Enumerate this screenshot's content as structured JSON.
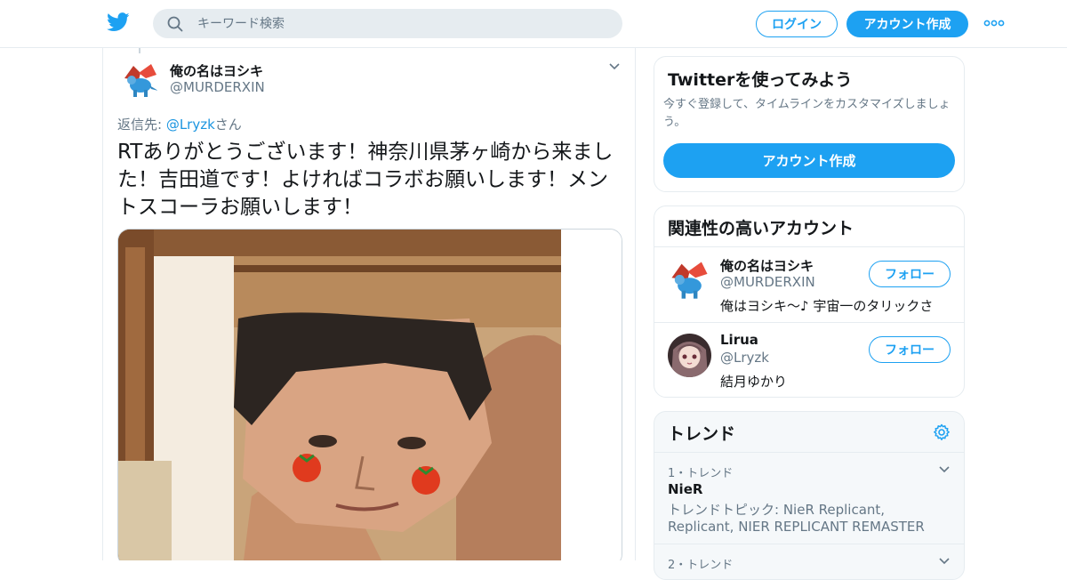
{
  "header": {
    "search_placeholder": "キーワード検索",
    "login_label": "ログイン",
    "signup_label": "アカウント作成"
  },
  "tweet": {
    "author_name": "俺の名はヨシキ",
    "author_handle": "@MURDERXIN",
    "replying_prefix": "返信先: ",
    "replying_handle": "@Lryzk",
    "replying_suffix": "さん",
    "text": "RTありがとうございます！神奈川県茅ヶ崎から来ました！吉田道です！よければコラボお願いします！メントスコーラお願いします！"
  },
  "signup_card": {
    "title": "Twitterを使ってみよう",
    "description": "今すぐ登録して、タイムラインをカスタマイズしましょう。",
    "button_label": "アカウント作成"
  },
  "related": {
    "title": "関連性の高いアカウント",
    "accounts": [
      {
        "name": "俺の名はヨシキ",
        "handle": "@MURDERXIN",
        "bio": "俺はヨシキ～♪ 宇宙一のタリックさ",
        "follow_label": "フォロー"
      },
      {
        "name": "Lirua",
        "handle": "@Lryzk",
        "bio": "結月ゆかり",
        "follow_label": "フォロー"
      }
    ]
  },
  "trends": {
    "title": "トレンド",
    "items": [
      {
        "meta": "1・トレンド",
        "name": "NieR",
        "description": "トレンドトピック: NieR Replicant, Replicant, NIER REPLICANT REMASTER"
      },
      {
        "meta": "2・トレンド",
        "name": "",
        "description": ""
      }
    ]
  },
  "colors": {
    "accent": "#1da1f2",
    "secondary_text": "#657786",
    "border": "#e6ecf0"
  }
}
